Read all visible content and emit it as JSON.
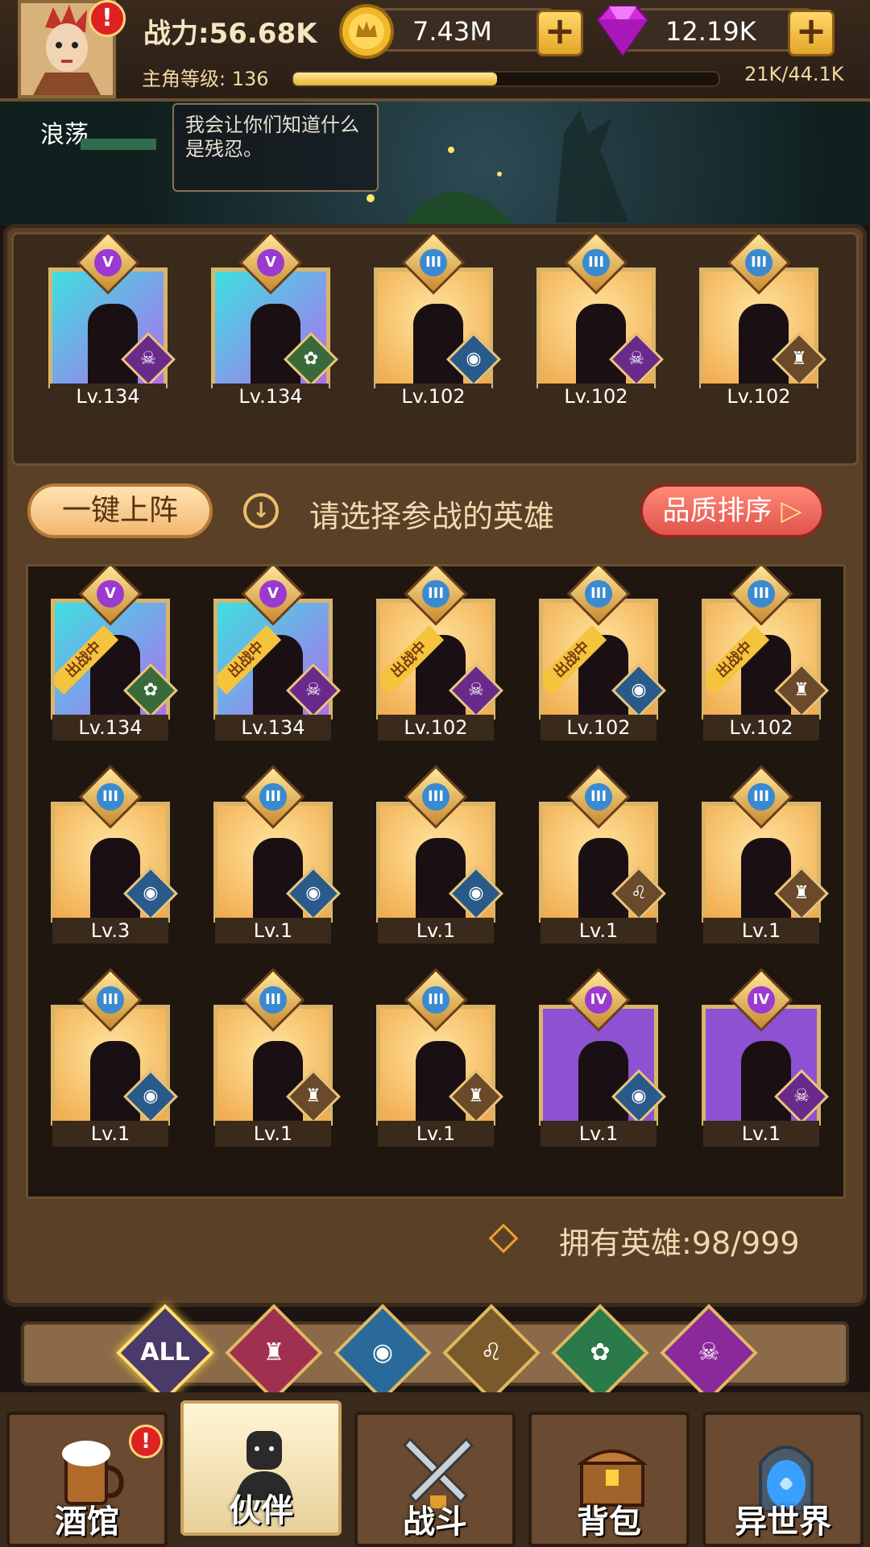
{
  "header": {
    "power_label": "战力:56.68K",
    "level_label": "主角等级:",
    "level_value": "136",
    "exp_text": "21K/44.1K",
    "exp_progress": 0.48,
    "gold": "7.43M",
    "gems": "12.19K"
  },
  "scene": {
    "npc_name": "浪荡",
    "speech": "我会让你们知道什么是残忍。"
  },
  "team": [
    {
      "level": "Lv.134",
      "rank": "V",
      "frame": "cyan",
      "faction": "demon"
    },
    {
      "level": "Lv.134",
      "rank": "V",
      "frame": "cyan",
      "faction": "elf"
    },
    {
      "level": "Lv.102",
      "rank": "III",
      "frame": "gold",
      "faction": "fish"
    },
    {
      "level": "Lv.102",
      "rank": "III",
      "frame": "gold",
      "faction": "demon"
    },
    {
      "level": "Lv.102",
      "rank": "III",
      "frame": "gold",
      "faction": "knight"
    }
  ],
  "controls": {
    "one_key_label": "一键上阵",
    "hint": "请选择参战的英雄",
    "sort_label": "品质排序"
  },
  "heroes": [
    {
      "level": "Lv.134",
      "rank": "V",
      "frame": "cyan",
      "faction": "elf",
      "deployed": true
    },
    {
      "level": "Lv.134",
      "rank": "V",
      "frame": "cyan",
      "faction": "demon",
      "deployed": true
    },
    {
      "level": "Lv.102",
      "rank": "III",
      "frame": "gold",
      "faction": "demon",
      "deployed": true
    },
    {
      "level": "Lv.102",
      "rank": "III",
      "frame": "gold",
      "faction": "fish",
      "deployed": true
    },
    {
      "level": "Lv.102",
      "rank": "III",
      "frame": "gold",
      "faction": "knight",
      "deployed": true
    },
    {
      "level": "Lv.3",
      "rank": "III",
      "frame": "gold",
      "faction": "fish",
      "deployed": false
    },
    {
      "level": "Lv.1",
      "rank": "III",
      "frame": "gold",
      "faction": "fish",
      "deployed": false
    },
    {
      "level": "Lv.1",
      "rank": "III",
      "frame": "gold",
      "faction": "fish",
      "deployed": false
    },
    {
      "level": "Lv.1",
      "rank": "III",
      "frame": "gold",
      "faction": "lion",
      "deployed": false
    },
    {
      "level": "Lv.1",
      "rank": "III",
      "frame": "gold",
      "faction": "knight",
      "deployed": false
    },
    {
      "level": "Lv.1",
      "rank": "III",
      "frame": "gold",
      "faction": "fish",
      "deployed": false
    },
    {
      "level": "Lv.1",
      "rank": "III",
      "frame": "gold",
      "faction": "knight",
      "deployed": false
    },
    {
      "level": "Lv.1",
      "rank": "III",
      "frame": "gold",
      "faction": "knight",
      "deployed": false
    },
    {
      "level": "Lv.1",
      "rank": "IV",
      "frame": "purple",
      "faction": "fish",
      "deployed": false
    },
    {
      "level": "Lv.1",
      "rank": "IV",
      "frame": "purple",
      "faction": "demon",
      "deployed": false
    }
  ],
  "deployed_tag": "出战中",
  "owned_label": "拥有英雄:",
  "owned_count": "98/999",
  "filters": [
    {
      "id": "all",
      "label": "ALL",
      "selected": true
    },
    {
      "id": "knight",
      "label": "",
      "selected": false
    },
    {
      "id": "fish",
      "label": "",
      "selected": false
    },
    {
      "id": "lion",
      "label": "",
      "selected": false
    },
    {
      "id": "elf",
      "label": "",
      "selected": false
    },
    {
      "id": "demon",
      "label": "",
      "selected": false
    }
  ],
  "nav": [
    {
      "id": "tavern",
      "label": "酒馆",
      "icon": "beer-mug-icon",
      "active": false,
      "alert": true
    },
    {
      "id": "partner",
      "label": "伙伴",
      "icon": "partner-icon",
      "active": true,
      "alert": false
    },
    {
      "id": "battle",
      "label": "战斗",
      "icon": "crossed-swords-icon",
      "active": false,
      "alert": false
    },
    {
      "id": "bag",
      "label": "背包",
      "icon": "treasure-chest-icon",
      "active": false,
      "alert": false
    },
    {
      "id": "otherworld",
      "label": "异世界",
      "icon": "portal-icon",
      "active": false,
      "alert": false
    }
  ],
  "alert_mark": "!",
  "colors": {
    "gold_frame": "#d9b46a",
    "purple_frame": "#8c52d1",
    "sort_button": "#e0534a",
    "exp_fill": "#e9b52e"
  }
}
